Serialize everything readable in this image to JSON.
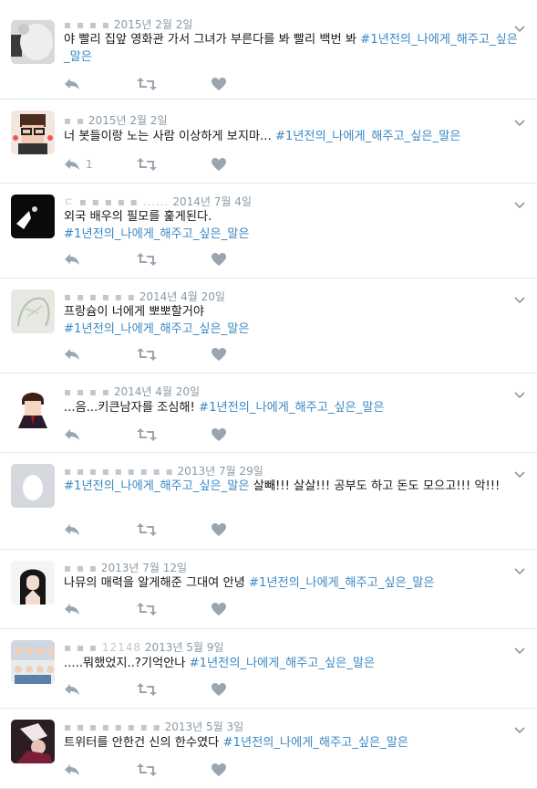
{
  "tweets": [
    {
      "name": "▪ ▪ ▪ ▪",
      "date": "2015년 2월 2일",
      "text": "야 빨리 집앞 영화관 가서 그녀가 부른다를 봐 빨리 백번 봐 ",
      "hashtag": "#1년전의_나에게_해주고_싶은_말은",
      "after": "",
      "reply_count": "",
      "avatar": "blurred-photo"
    },
    {
      "name": "▪ ▪",
      "date": "2015년 2월 2일",
      "text": "너 봇들이랑 노는 사람 이상하게 보지마... ",
      "hashtag": "#1년전의_나에게_해주고_싶은_말은",
      "after": "",
      "reply_count": "1",
      "avatar": "pixel-glasses-character"
    },
    {
      "name": "ㄷ ▪ ▪ ▪ ▪ ▪ ......",
      "date": "2014년 7월 4일",
      "text": "외국 배우의 필모를 훑게된다. ",
      "hashtag": "#1년전의_나에게_해주고_싶은_말은",
      "after": "",
      "reply_count": "",
      "avatar": "dark-silhouette"
    },
    {
      "name": "▪ ▪ ▪ ▪ ▪ ▪",
      "date": "2014년 4월 20일",
      "text": "프랑슘이 너에게 뽀뽀할거야 ",
      "hashtag": "#1년전의_나에게_해주고_싶은_말은",
      "after": "",
      "reply_count": "",
      "avatar": "sketch-drawing"
    },
    {
      "name": "▪ ▪ ▪ ▪",
      "date": "2014년 4월 20일",
      "text": "...음...키큰남자를 조심해! ",
      "hashtag": "#1년전의_나에게_해주고_싶은_말은",
      "after": "",
      "reply_count": "",
      "avatar": "anime-boy-suit"
    },
    {
      "name": "▪ ▪ ▪ ▪ ▪ ▪ ▪ ▪ ▪",
      "date": "2013년 7월 29일",
      "text": "",
      "hashtag": "#1년전의_나에게_해주고_싶은_말은",
      "after": " 살빼!!! 살살!!! 공부도 하고 돈도 모으고!!! 악!!!",
      "reply_count": "",
      "avatar": "default-egg"
    },
    {
      "name": "▪ ▪ ▪",
      "date": "2013년 7월 12일",
      "text": "나뮤의 매력을 알게해준 그대여 안녕 ",
      "hashtag": "#1년전의_나에게_해주고_싶은_말은",
      "after": "",
      "reply_count": "",
      "avatar": "girl-portrait"
    },
    {
      "name": "▪ ▪ ▪ 12148",
      "date": "2013년 5월 9일",
      "text": ".....뭐했었지..?기억안나 ",
      "hashtag": "#1년전의_나에게_해주고_싶은_말은",
      "after": "",
      "reply_count": "",
      "avatar": "group-photo"
    },
    {
      "name": "▪ ▪ ▪ ▪ ▪ ▪ ▪ ▪",
      "date": "2013년 5월 3일",
      "text": "트위터를 안한건 신의 한수였다 ",
      "hashtag": "#1년전의_나에게_해주고_싶은_말은",
      "after": "",
      "reply_count": "",
      "avatar": "dark-photo"
    }
  ],
  "colors": {
    "hashtag": "#3b88c3",
    "meta": "#8899a6",
    "icon": "#9aa5b1",
    "divider": "#e1e8ed"
  }
}
